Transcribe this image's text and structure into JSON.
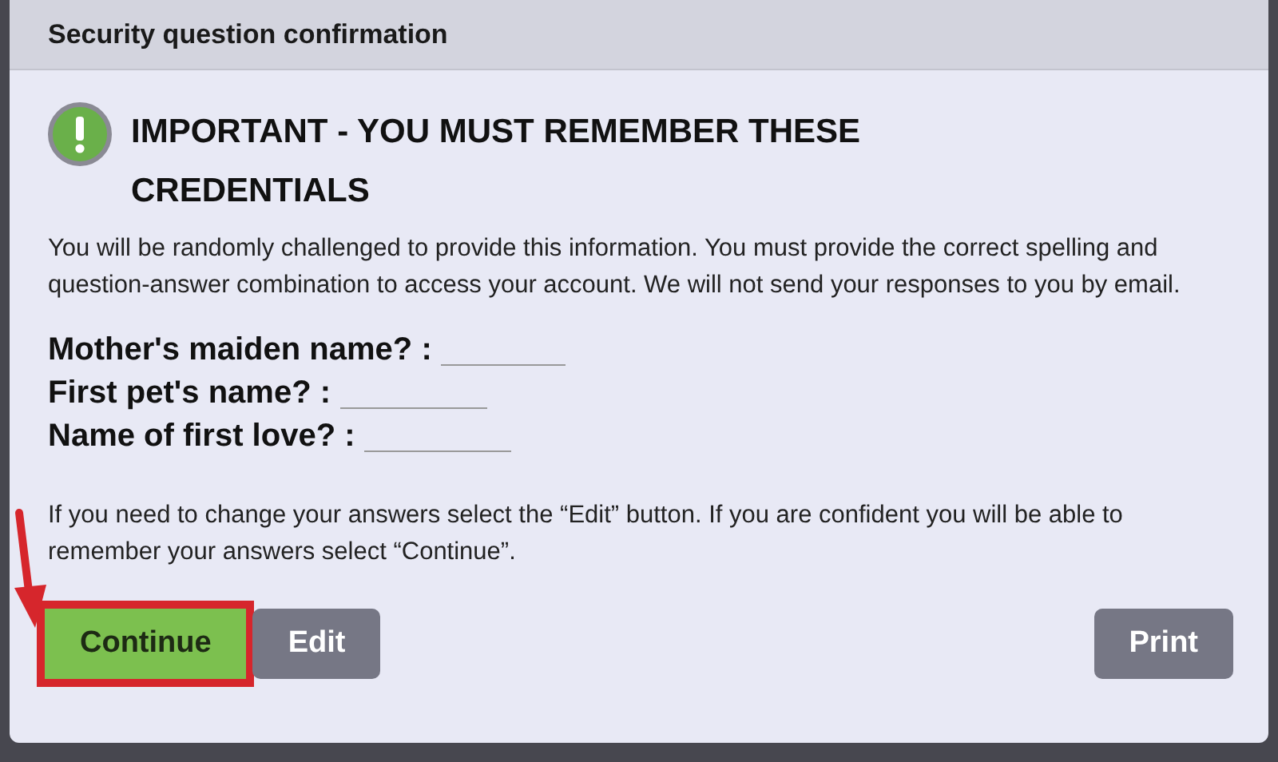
{
  "dialog": {
    "title": "Security question confirmation"
  },
  "notice": {
    "heading": "IMPORTANT - YOU MUST REMEMBER THESE CREDENTIALS",
    "text": "You will be randomly challenged to provide this information. You must provide the correct spelling and question-answer combination to access your account. We will not send your responses to you by email."
  },
  "questions": [
    {
      "label": "Mother's maiden name? :"
    },
    {
      "label": "First pet's name? :"
    },
    {
      "label": "Name of first love? :"
    }
  ],
  "instructions": "If you need to change your answers select the “Edit” button. If you are confident you will be able to remember your answers select “Continue”.",
  "buttons": [
    {
      "label": "Continue",
      "kind": "primary",
      "highlighted": true
    },
    {
      "label": "Edit",
      "kind": "secondary",
      "highlighted": false
    },
    {
      "label": "Print",
      "kind": "right",
      "highlighted": false
    }
  ]
}
